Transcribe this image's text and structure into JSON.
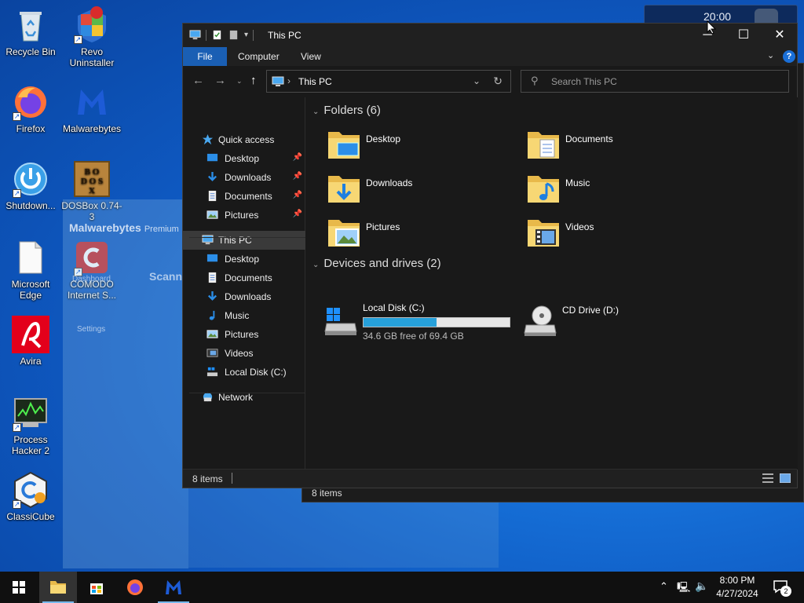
{
  "desktop": {
    "icons": [
      {
        "label": "Recycle Bin",
        "icon": "recycle-bin-icon"
      },
      {
        "label": "Revo Uninstaller",
        "icon": "revo-uninstaller-icon"
      },
      {
        "label": "Firefox",
        "icon": "firefox-icon"
      },
      {
        "label": "Malwarebytes",
        "icon": "malwarebytes-icon"
      },
      {
        "label": "Shutdown...",
        "icon": "shutdown-icon"
      },
      {
        "label": "DOSBox 0.74-3",
        "icon": "dosbox-icon"
      },
      {
        "label": "Microsoft Edge",
        "icon": "edge-icon"
      },
      {
        "label": "COMODO Internet S...",
        "icon": "comodo-icon"
      },
      {
        "label": "Avira",
        "icon": "avira-icon"
      },
      {
        "label": "Process Hacker 2",
        "icon": "process-hacker-icon"
      },
      {
        "label": "ClassiCube",
        "icon": "classicube-icon"
      }
    ],
    "ghost_malwarebytes": {
      "brand": "Malwarebytes",
      "edition": "Premium",
      "scanner": "Scanne",
      "settings": "Settings",
      "dashboard": "Dashboard"
    },
    "clock_widget": {
      "time": "20:00"
    }
  },
  "back_window": {
    "status": "8 items"
  },
  "explorer": {
    "title": "This PC",
    "ribbon_tabs": [
      "File",
      "Computer",
      "View"
    ],
    "address": {
      "crumb": "This PC"
    },
    "search": {
      "placeholder": "Search This PC"
    },
    "nav": [
      {
        "label": "Quick access",
        "icon": "star-icon",
        "indent": 0
      },
      {
        "label": "Desktop",
        "icon": "desktop-icon",
        "indent": 1,
        "pinned": true
      },
      {
        "label": "Downloads",
        "icon": "download-icon",
        "indent": 1,
        "pinned": true
      },
      {
        "label": "Documents",
        "icon": "document-icon",
        "indent": 1,
        "pinned": true
      },
      {
        "label": "Pictures",
        "icon": "pictures-icon",
        "indent": 1,
        "pinned": true
      },
      {
        "label": "This PC",
        "icon": "computer-icon",
        "indent": 0,
        "selected": true
      },
      {
        "label": "Desktop",
        "icon": "desktop-icon",
        "indent": 1
      },
      {
        "label": "Documents",
        "icon": "document-icon",
        "indent": 1
      },
      {
        "label": "Downloads",
        "icon": "download-icon",
        "indent": 1
      },
      {
        "label": "Music",
        "icon": "music-icon",
        "indent": 1
      },
      {
        "label": "Pictures",
        "icon": "pictures-icon",
        "indent": 1
      },
      {
        "label": "Videos",
        "icon": "videos-icon",
        "indent": 1
      },
      {
        "label": "Local Disk (C:)",
        "icon": "drive-icon",
        "indent": 1
      },
      {
        "label": "Network",
        "icon": "network-icon",
        "indent": 0
      }
    ],
    "folders_heading": "Folders (6)",
    "folders": [
      {
        "label": "Desktop",
        "icon": "desktop-folder-icon"
      },
      {
        "label": "Documents",
        "icon": "documents-folder-icon"
      },
      {
        "label": "Downloads",
        "icon": "downloads-folder-icon"
      },
      {
        "label": "Music",
        "icon": "music-folder-icon"
      },
      {
        "label": "Pictures",
        "icon": "pictures-folder-icon"
      },
      {
        "label": "Videos",
        "icon": "videos-folder-icon"
      }
    ],
    "drives_heading": "Devices and drives (2)",
    "drives": [
      {
        "label": "Local Disk (C:)",
        "free": "34.6 GB free of 69.4 GB",
        "used_fraction": 0.5
      },
      {
        "label": "CD Drive (D:)"
      }
    ],
    "status": "8 items"
  },
  "taskbar": {
    "apps": [
      "start-icon",
      "file-explorer-icon",
      "store-icon",
      "firefox-icon",
      "malwarebytes-icon"
    ],
    "clock_time": "8:00 PM",
    "clock_date": "4/27/2024",
    "notifications": "2"
  },
  "colors": {
    "accent": "#1a5fb4",
    "drive_fill": "#26a0da",
    "taskbar": "#101010"
  }
}
